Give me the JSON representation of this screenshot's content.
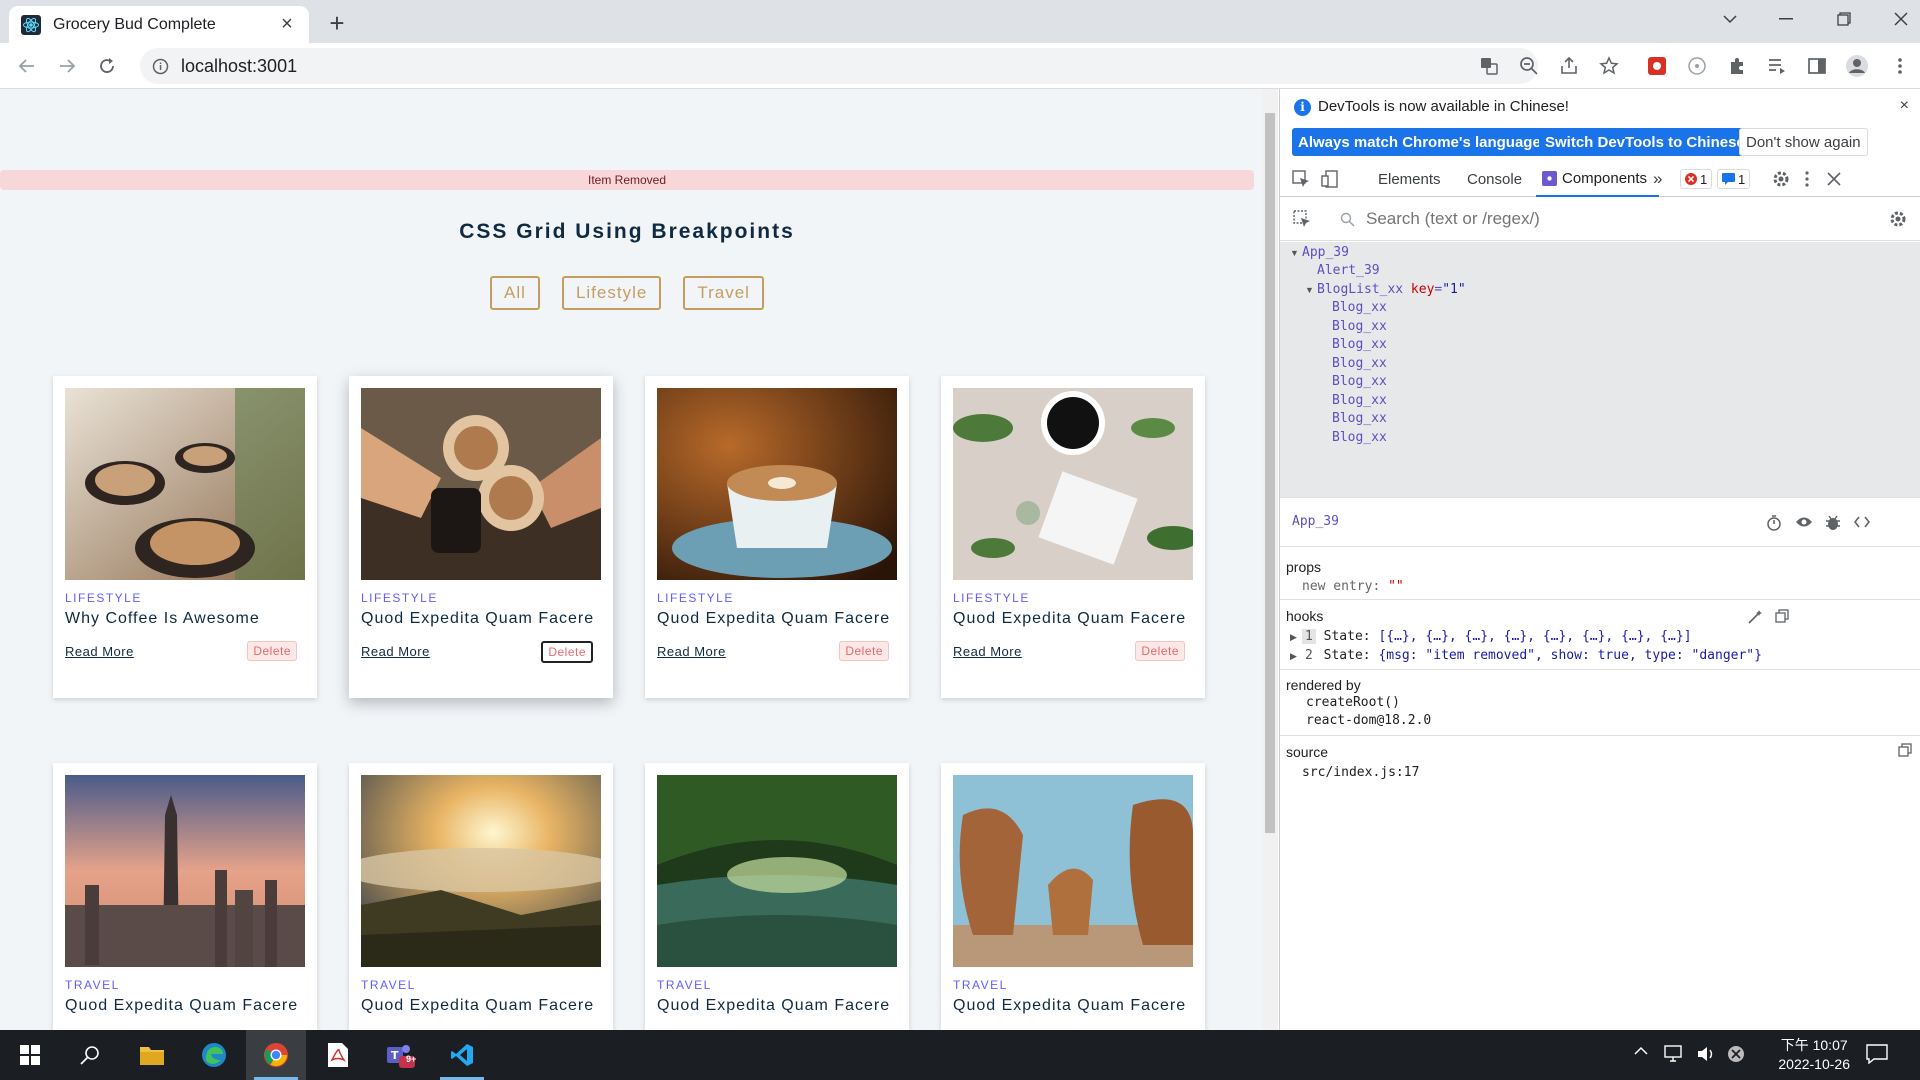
{
  "browser": {
    "tab_title": "Grocery Bud Complete",
    "url": "localhost:3001"
  },
  "page": {
    "alert": "Item Removed",
    "title": "CSS Grid Using Breakpoints",
    "filters": [
      "All",
      "Lifestyle",
      "Travel"
    ],
    "read_more": "Read More",
    "delete_label": "Delete",
    "cards": [
      {
        "category": "LIFESTYLE",
        "title": "Why Coffee Is Awesome",
        "image": "latte-cups-photo"
      },
      {
        "category": "LIFESTYLE",
        "title": "Quod Expedita Quam Facere",
        "image": "coffee-toast-photo"
      },
      {
        "category": "LIFESTYLE",
        "title": "Quod Expedita Quam Facere",
        "image": "coffee-cup-photo"
      },
      {
        "category": "LIFESTYLE",
        "title": "Quod Expedita Quam Facere",
        "image": "coffee-leaves-photo"
      },
      {
        "category": "TRAVEL",
        "title": "Quod Expedita Quam Facere",
        "image": "city-skyline-photo"
      },
      {
        "category": "TRAVEL",
        "title": "Quod Expedita Quam Facere",
        "image": "mountain-sunrise-photo"
      },
      {
        "category": "TRAVEL",
        "title": "Quod Expedita Quam Facere",
        "image": "green-river-photo"
      },
      {
        "category": "TRAVEL",
        "title": "Quod Expedita Quam Facere",
        "image": "rock-formation-photo"
      }
    ]
  },
  "devtools": {
    "info_message": "DevTools is now available in Chinese!",
    "btn_match": "Always match Chrome's language",
    "btn_switch": "Switch DevTools to Chinese",
    "btn_dont_show": "Don't show again",
    "tabs": [
      "Elements",
      "Console",
      "Components"
    ],
    "error_count": "1",
    "message_count": "1",
    "search_placeholder": "Search (text or /regex/)",
    "tree": {
      "root": "App_39",
      "alert": "Alert_39",
      "bloglist": "BlogList_xx",
      "bloglist_key_name": "key",
      "bloglist_key_value": "\"1\"",
      "blog": "Blog_xx"
    },
    "selected_component": "App_39",
    "props_label": "props",
    "prop_name": "new entry",
    "prop_value": "\"\"",
    "hooks_label": "hooks",
    "hook1_index": "1",
    "hook1_name": "State",
    "hook1_value": "[{…}, {…}, {…}, {…}, {…}, {…}, {…}, {…}]",
    "hook2_index": "2",
    "hook2_name": "State",
    "hook2_value": "{msg: \"item removed\", show: true, type: \"danger\"}",
    "rendered_by_label": "rendered by",
    "rendered_by": [
      "createRoot()",
      "react-dom@18.2.0"
    ],
    "source_label": "source",
    "source_value": "src/index.js:17"
  },
  "taskbar": {
    "time": "下午 10:07",
    "date": "2022-10-26",
    "teams_badge": "9+"
  },
  "colors": {
    "accent_gold": "#c59d5f",
    "category_purple": "#645cff",
    "alert_bg": "#f8d7da",
    "devtools_blue": "#1a73e8"
  }
}
